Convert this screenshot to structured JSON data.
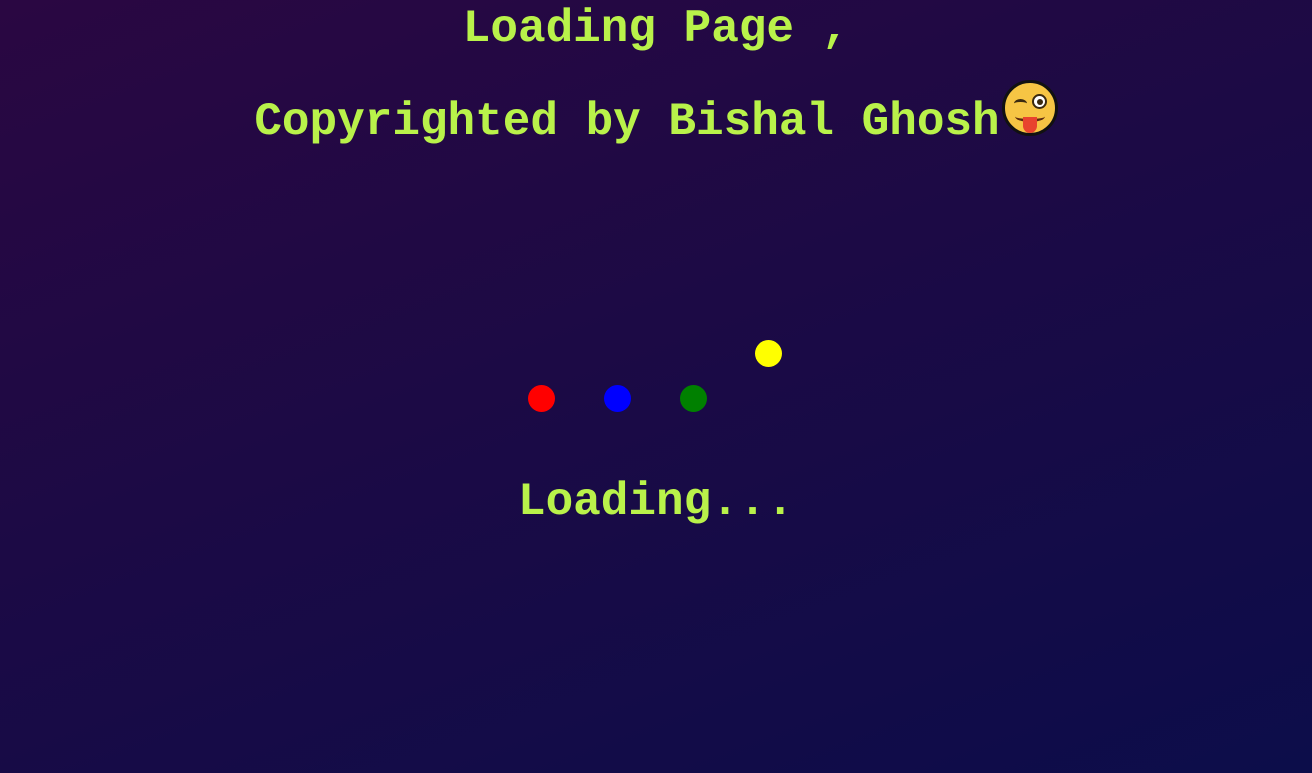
{
  "header": {
    "line1": "Loading Page ,",
    "line2": "Copyrighted by Bishal Ghosh",
    "emoji": "winking-face-with-tongue-icon"
  },
  "loader": {
    "dots": [
      {
        "name": "red",
        "color": "#ff0000"
      },
      {
        "name": "blue",
        "color": "#0000ff"
      },
      {
        "name": "green",
        "color": "#008000"
      },
      {
        "name": "yellow",
        "color": "#ffff00"
      }
    ],
    "text": "Loading..."
  },
  "colors": {
    "text": "#b9f24a",
    "background_start": "#2a0742",
    "background_end": "#0c0d4a"
  }
}
